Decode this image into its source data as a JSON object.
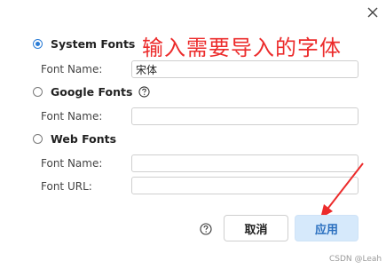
{
  "dialog": {
    "close_icon": "close-icon"
  },
  "annotation_text": "输入需要导入的字体",
  "system_fonts": {
    "label": "System Fonts",
    "selected": true,
    "font_name_label": "Font Name:",
    "font_name_value": "宋体"
  },
  "google_fonts": {
    "label": "Google Fonts",
    "selected": false,
    "help_icon": "question-circle-icon",
    "font_name_label": "Font Name:",
    "font_name_value": ""
  },
  "web_fonts": {
    "label": "Web Fonts",
    "selected": false,
    "font_name_label": "Font Name:",
    "font_name_value": "",
    "font_url_label": "Font URL:",
    "font_url_value": ""
  },
  "footer": {
    "help_icon": "question-circle-icon",
    "cancel_label": "取消",
    "apply_label": "应用"
  },
  "watermark": "CSDN @Leah",
  "colors": {
    "accent": "#2a7cd6",
    "annotation": "#ec2b2b",
    "apply_bg": "#d6e9fb"
  }
}
